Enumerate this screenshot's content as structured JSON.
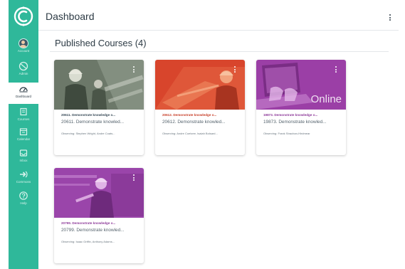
{
  "nav": {
    "logo_icon": "canvas-logo-icon",
    "items": [
      {
        "label": "Account",
        "icon": "avatar"
      },
      {
        "label": "Admin",
        "icon": "shield-icon"
      },
      {
        "label": "Dashboard",
        "icon": "dashboard-icon",
        "active": true
      },
      {
        "label": "Courses",
        "icon": "book-icon"
      },
      {
        "label": "Calendar",
        "icon": "calendar-icon"
      },
      {
        "label": "Inbox",
        "icon": "inbox-icon"
      },
      {
        "label": "Commons",
        "icon": "commons-icon"
      },
      {
        "label": "Help",
        "icon": "help-icon"
      }
    ],
    "color": "#2fb89a"
  },
  "header": {
    "title": "Dashboard"
  },
  "section": {
    "title": "Published Courses (4)"
  },
  "courses": [
    {
      "title": "20611. Demonstrate knowledge o...",
      "subtitle": "20611. Demonstrate knowled...",
      "term": "Observing: Stephen Wright, Andre Coats...",
      "color": "#5e6b5c",
      "title_color": "#394b58",
      "hero": "worker-hardhat"
    },
    {
      "title": "20612. Demonstrate knowledge o...",
      "subtitle": "20612. Demonstrate knowled...",
      "term": "Observing: Andre Coetzee, Isaiah Bolsard...",
      "color": "#d8452c",
      "title_color": "#c8402a",
      "hero": "worker-red"
    },
    {
      "title": "19873. Demonstrate knowledge o...",
      "subtitle": "19873. Demonstrate knowled...",
      "term": "Observing: Frank Strachan-Hirdmear",
      "color": "#9b3fa6",
      "title_color": "#8e3b9a",
      "hero": "laptop-online",
      "hero_text": "Online"
    },
    {
      "title": "20799. Demonstrate knowledge o...",
      "subtitle": "20799. Demonstrate knowled...",
      "term": "Observing: Isaac Griffin, Anthony Adams...",
      "color": "#a64fb7",
      "title_color": "#8e3b9a",
      "hero": "worker-purple"
    }
  ]
}
